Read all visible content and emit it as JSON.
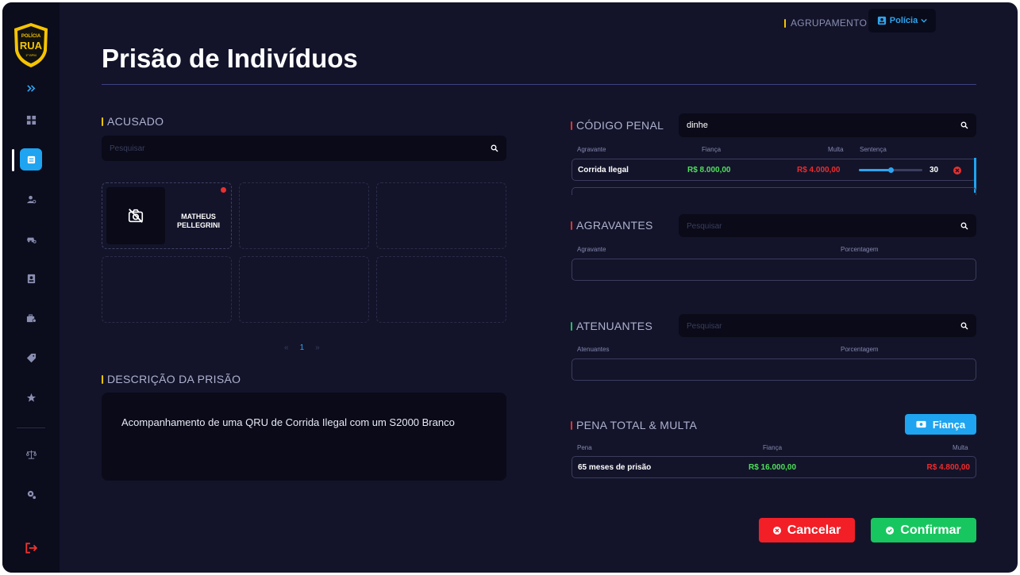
{
  "header": {
    "title": "Prisão de Indivíduos",
    "agrupamento_label": "AGRUPAMENTO",
    "agrupamento_value": "Polícia"
  },
  "logo": {
    "text": "POLÍCIA",
    "accent": "#f5c400"
  },
  "sidebar": {
    "items": [
      {
        "icon": "expand-icon"
      },
      {
        "icon": "dashboard-icon"
      },
      {
        "icon": "arrest-icon",
        "active": true
      },
      {
        "icon": "person-search-icon"
      },
      {
        "icon": "vehicle-search-icon"
      },
      {
        "icon": "records-icon"
      },
      {
        "icon": "briefcase-icon"
      },
      {
        "icon": "tag-icon"
      },
      {
        "icon": "star-icon"
      },
      {
        "icon": "scale-icon"
      },
      {
        "icon": "settings-icon"
      },
      {
        "icon": "logout-icon"
      }
    ]
  },
  "acusado": {
    "label": "ACUSADO",
    "search_placeholder": "Pesquisar",
    "cards": [
      {
        "name": "MATHEUS PELLEGRINI",
        "filled": true
      },
      {
        "name": "",
        "filled": false
      },
      {
        "name": "",
        "filled": false
      },
      {
        "name": "",
        "filled": false
      },
      {
        "name": "",
        "filled": false
      },
      {
        "name": "",
        "filled": false
      }
    ],
    "pager": {
      "prev": "«",
      "current": "1",
      "next": "»"
    }
  },
  "descricao": {
    "label": "DESCRIÇÃO DA PRISÃO",
    "text": "Acompanhamento de uma QRU de Corrida Ilegal com um S2000 Branco"
  },
  "codigo_penal": {
    "label": "CÓDIGO PENAL",
    "search_value": "dinhe",
    "headers": {
      "agravante": "Agravante",
      "fianca": "Fiança",
      "multa": "Multa",
      "sentenca": "Sentença"
    },
    "rows": [
      {
        "name": "Corrida Ilegal",
        "fianca": "R$ 8.000,00",
        "multa": "R$ 4.000,00",
        "sentenca": "30",
        "slider_fraction": 0.5
      }
    ]
  },
  "agravantes": {
    "label": "AGRAVANTES",
    "search_placeholder": "Pesquisar",
    "headers": {
      "col1": "Agravante",
      "col2": "Porcentagem"
    }
  },
  "atenuantes": {
    "label": "ATENUANTES",
    "search_placeholder": "Pesquisar",
    "headers": {
      "col1": "Atenuantes",
      "col2": "Porcentagem"
    }
  },
  "pena": {
    "label": "PENA TOTAL & MULTA",
    "fianca_button": "Fiança",
    "headers": {
      "pena": "Pena",
      "fianca": "Fiança",
      "multa": "Multa"
    },
    "total": {
      "pena": "65 meses de prisão",
      "fianca": "R$ 16.000,00",
      "multa": "R$ 4.800,00"
    }
  },
  "actions": {
    "cancel": "Cancelar",
    "confirm": "Confirmar"
  },
  "colors": {
    "accent_blue": "#1ea4f0",
    "green_value": "#4fe05a",
    "red_value": "#f22a2a",
    "yellow_bar": "#f5c400",
    "red_bar": "#e8302f",
    "green_bar": "#18c65f"
  }
}
